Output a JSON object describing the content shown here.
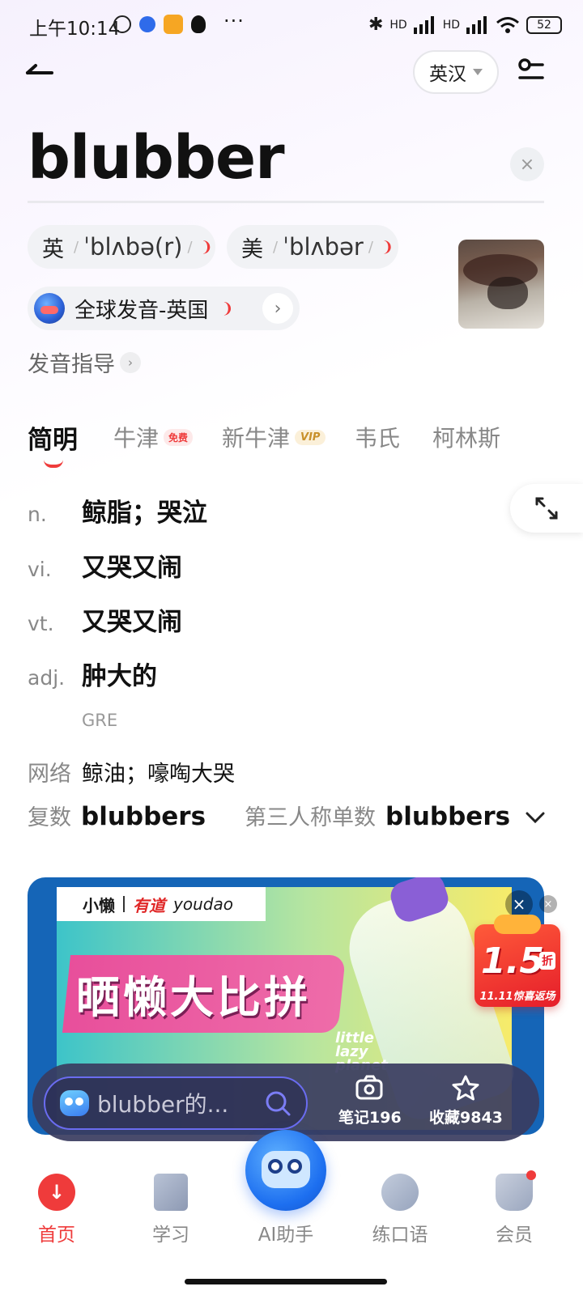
{
  "status_bar": {
    "time": "上午10:14",
    "dots": "···",
    "network_hd1": "HD",
    "network_hd2": "HD",
    "battery": "52"
  },
  "header": {
    "lang_toggle": "英汉"
  },
  "word": {
    "headword": "blubber",
    "clear_symbol": "×"
  },
  "pronunciation": {
    "uk_region": "英",
    "uk_ipa": "ˈblʌbə(r)",
    "us_region": "美",
    "us_ipa": "ˈblʌbər",
    "global_label": "全球发音-英国",
    "guide_label": "发音指导"
  },
  "tabs": [
    {
      "label": "简明",
      "active": true
    },
    {
      "label": "牛津",
      "badge": "免费"
    },
    {
      "label": "新牛津",
      "badge": "VIP"
    },
    {
      "label": "韦氏"
    },
    {
      "label": "柯林斯"
    }
  ],
  "definitions": [
    {
      "pos": "n.",
      "meaning": "鲸脂；哭泣"
    },
    {
      "pos": "vi.",
      "meaning": "又哭又闹"
    },
    {
      "pos": "vt.",
      "meaning": "又哭又闹"
    },
    {
      "pos": "adj.",
      "meaning": "肿大的"
    }
  ],
  "exam_tag": "GRE",
  "network": {
    "label": "网络",
    "text": "鲸油；嚎啕大哭"
  },
  "forms": {
    "plural_label": "复数",
    "plural_value": "blubbers",
    "third_label": "第三人称单数",
    "third_value": "blubbers"
  },
  "ad": {
    "brand_left": "小懒",
    "brand_right": "有道",
    "brand_youdao": "youdao",
    "title": "晒懒大比拼",
    "slogan": "little lazy planet",
    "close_symbol": "×",
    "promo_number": "1.5",
    "promo_unit": "折",
    "promo_text": "11.11惊喜返场"
  },
  "float_bar": {
    "search_placeholder": "blubber的...",
    "notes_label": "笔记196",
    "favorites_label": "收藏9843"
  },
  "bottom_nav": {
    "home": "首页",
    "study": "学习",
    "ai": "AI助手",
    "speak": "练口语",
    "vip": "会员"
  },
  "colors": {
    "accent": "#ef3b3b",
    "ad_frame": "#1565b7",
    "ai_blue": "#1d6ff0"
  }
}
